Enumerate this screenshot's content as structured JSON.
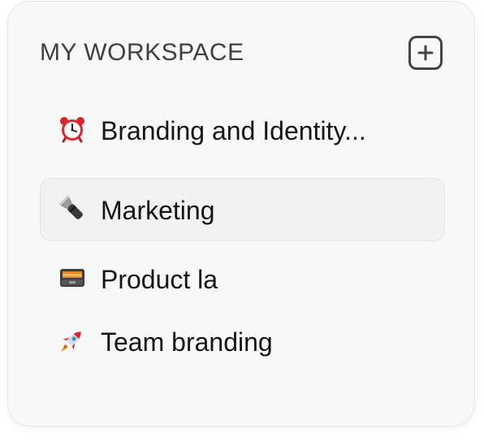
{
  "workspace": {
    "title": "MY WORKSPACE",
    "add_icon": "plus-square-icon",
    "items": [
      {
        "label": "Branding and Identity...",
        "icon": "alarm-clock-icon",
        "selected": false
      },
      {
        "label": "Marketing",
        "icon": "flashlight-icon",
        "selected": true
      },
      {
        "label": "Product la",
        "icon": "card-file-box-icon",
        "selected": false
      },
      {
        "label": "Team branding",
        "icon": "rocket-icon",
        "selected": false
      }
    ]
  },
  "colors": {
    "panel_background": "#f8f8f8",
    "selected_background": "#f2f2f2",
    "text": "#151515",
    "header_text": "#404040"
  }
}
